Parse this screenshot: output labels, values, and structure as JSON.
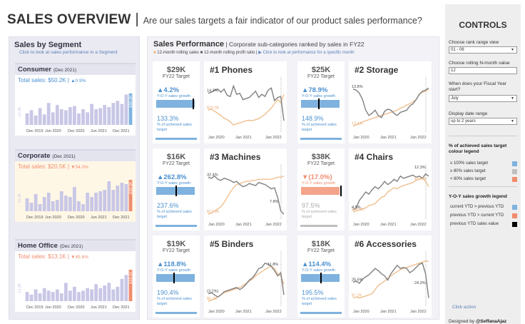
{
  "header": {
    "title": "SALES OVERVIEW",
    "separator": "|",
    "subtitle": "Are our sales targets a fair indicator of our product sales performance?"
  },
  "colors": {
    "blue": "#7fb2de",
    "orange": "#f08c6e",
    "gray": "#bfbfbf",
    "lavender": "#c9c7e6",
    "segment_blue_text": "#4a90d0",
    "segment_orange_text": "#f08c6e",
    "rolling_sales_line": "#f0c090",
    "rolling_profit_line": "#808080"
  },
  "segments": {
    "title": "Sales by Segment",
    "hint": "Click to look at sales performance in a Segment",
    "axis_labels": [
      "Dec 2019",
      "Jun 2020",
      "Dec 2020",
      "Jun 2021",
      "Dec 2021"
    ],
    "items": [
      {
        "name": "Consumer",
        "date": "(Dec 2021)",
        "total_text": "Total sales: $50.2K | ",
        "growth_text": "▲0.9%",
        "color": "#4a90d0",
        "highlight_color": "#7fb2de",
        "first_label": "£1.0K",
        "last_label": "£50.2K",
        "values": [
          22,
          28,
          18,
          32,
          20,
          42,
          24,
          38,
          30,
          28,
          34,
          36,
          22,
          30,
          24,
          40,
          30,
          32,
          38,
          34,
          42,
          46,
          40,
          58,
          60
        ]
      },
      {
        "name": "Corporate",
        "date": "(Dec 2021)",
        "total_text": "Total sales: $20.5K | ",
        "growth_text": "▼54.0%",
        "color": "#f08c6e",
        "highlight_color": "#f08c6e",
        "first_label": "£3.5K",
        "last_label": "£20.5K",
        "values": [
          18,
          12,
          24,
          10,
          20,
          26,
          14,
          16,
          28,
          22,
          20,
          34,
          14,
          10,
          26,
          20,
          26,
          28,
          30,
          42,
          30,
          36,
          40,
          38,
          44
        ]
      },
      {
        "name": "Home Office",
        "date": "(Dec 2021)",
        "total_text": "Total sales: $13.1K | ",
        "growth_text": "▼45.6%",
        "color": "#f08c6e",
        "highlight_color": "#f08c6e",
        "first_label": "£1.0K",
        "last_label": "£13.1K",
        "values": [
          14,
          10,
          18,
          12,
          20,
          16,
          14,
          18,
          12,
          28,
          16,
          22,
          14,
          16,
          20,
          18,
          26,
          20,
          24,
          28,
          18,
          22,
          34,
          40,
          48
        ]
      }
    ]
  },
  "performance": {
    "title": "Sales Performance",
    "separator": " | ",
    "subtitle": "Corporate sub-categories ranked by sales in FY22",
    "legend_item1": "12-month rolling sales",
    "legend_item2": "12-month rolling profit ratio",
    "legend_sep": " | ",
    "legend_click": "▶ Click to look at performance for a specific month",
    "axis_labels": [
      "Jan 2020",
      "Jan 2021",
      "Jan 2022"
    ],
    "target_label": "FY22 Target",
    "growth_label": "Y-O-Y sales growth",
    "achieved_label": "% of achieved sales target",
    "tiles": [
      {
        "rank": "#1 Phones",
        "target": "$29K",
        "growth": "▲4.2%",
        "growth_color": "#4a90d0",
        "growth_bar_color": "#7fb2de",
        "marker_pos": 0.95,
        "achieved": "133.3%",
        "achieved_color": "#4a90d0",
        "achieved_fill": 1.0,
        "sales_label": "$29.6K",
        "profit_label": "14.3%",
        "sales": [
          60,
          58,
          62,
          66,
          70,
          75,
          78,
          82,
          88,
          86,
          84,
          82,
          80,
          79,
          80,
          78,
          76,
          72,
          68,
          62,
          56,
          48,
          40,
          46,
          30
        ],
        "profit": [
          28,
          26,
          22,
          20,
          26,
          20,
          32,
          34,
          14,
          30,
          28,
          40,
          38,
          36,
          30,
          24,
          36,
          30,
          34,
          22,
          18,
          42,
          36,
          34,
          80
        ]
      },
      {
        "rank": "#2 Storage",
        "target": "$25K",
        "growth": "▲78.9%",
        "growth_color": "#4a90d0",
        "growth_bar_color": "#7fb2de",
        "marker_pos": 0.45,
        "achieved": "148.9%",
        "achieved_color": "#4a90d0",
        "achieved_fill": 1.0,
        "sales_label": "13.4%",
        "profit_label": "13.8%",
        "sales": [
          90,
          88,
          86,
          82,
          80,
          78,
          76,
          74,
          72,
          70,
          68,
          66,
          64,
          62,
          60,
          56,
          54,
          50,
          48,
          44,
          40,
          30,
          26,
          24,
          20
        ],
        "profit": [
          20,
          22,
          28,
          40,
          60,
          70,
          66,
          60,
          70,
          74,
          62,
          58,
          60,
          66,
          70,
          64,
          62,
          60,
          52,
          48,
          40,
          30,
          24,
          22,
          18
        ]
      },
      {
        "rank": "#3 Machines",
        "target": "$16K",
        "growth": "▲262.8%",
        "growth_color": "#4a90d0",
        "growth_bar_color": "#7fb2de",
        "marker_pos": 0.5,
        "achieved": "237.6%",
        "achieved_color": "#4a90d0",
        "achieved_fill": 1.0,
        "sales_label": "$17.9K",
        "profit_label": "32.4%",
        "sales": [
          92,
          90,
          86,
          82,
          78,
          70,
          60,
          50,
          42,
          36,
          34,
          32,
          30,
          30,
          28,
          28,
          26,
          26,
          26,
          26,
          26,
          24,
          22,
          22,
          20
        ],
        "profit": [
          22,
          24,
          20,
          26,
          28,
          24,
          26,
          28,
          32,
          30,
          36,
          40,
          38,
          34,
          36,
          38,
          32,
          34,
          36,
          40,
          44,
          42,
          60,
          86,
          92
        ]
      },
      {
        "rank": "#4 Chairs",
        "target": "$38K",
        "growth": "▼(17.0%)",
        "growth_color": "#f08c6e",
        "growth_bar_color": "#f4a48a",
        "marker_pos": 1.05,
        "achieved": "97.5%",
        "achieved_color": "#aaaaaa",
        "achieved_fill": 0.9,
        "sales_label": "$38.6K",
        "profit_label": "4.5%",
        "sales": [
          88,
          86,
          84,
          82,
          80,
          76,
          74,
          72,
          66,
          60,
          58,
          50,
          46,
          42,
          44,
          40,
          38,
          36,
          34,
          32,
          28,
          26,
          24,
          30,
          40
        ],
        "profit": [
          84,
          80,
          66,
          58,
          50,
          54,
          46,
          40,
          44,
          38,
          30,
          36,
          32,
          26,
          30,
          20,
          24,
          22,
          20,
          18,
          22,
          20,
          24,
          16,
          20
        ]
      },
      {
        "rank": "#5 Binders",
        "target": "$19K",
        "growth": "▲118.8%",
        "growth_color": "#4a90d0",
        "growth_bar_color": "#7fb2de",
        "marker_pos": 0.45,
        "achieved": "190.4%",
        "achieved_color": "#4a90d0",
        "achieved_fill": 1.0,
        "sales_label": "$6.2K",
        "profit_label": "(3.1%)",
        "sales": [
          92,
          90,
          88,
          84,
          80,
          76,
          74,
          72,
          70,
          68,
          66,
          62,
          58,
          54,
          50,
          44,
          40,
          36,
          32,
          28,
          26,
          30,
          40,
          44,
          60
        ],
        "profit": [
          78,
          76,
          80,
          84,
          80,
          74,
          72,
          70,
          68,
          66,
          70,
          66,
          60,
          52,
          48,
          40,
          30,
          28,
          20,
          22,
          26,
          34,
          44,
          38,
          80
        ]
      },
      {
        "rank": "#6 Accessories",
        "target": "$18K",
        "growth": "▲114.4%",
        "growth_color": "#4a90d0",
        "growth_bar_color": "#7fb2de",
        "marker_pos": 0.5,
        "achieved": "195.5%",
        "achieved_color": "#4a90d0",
        "achieved_fill": 1.0,
        "sales_label": "$7.2K",
        "profit_label": "25.6%",
        "sales": [
          86,
          84,
          86,
          84,
          82,
          80,
          78,
          70,
          62,
          58,
          54,
          48,
          44,
          40,
          36,
          32,
          30,
          28,
          26,
          24,
          22,
          20,
          18,
          16,
          16
        ],
        "profit": [
          56,
          54,
          58,
          50,
          46,
          42,
          36,
          30,
          34,
          40,
          44,
          52,
          40,
          32,
          24,
          30,
          28,
          30,
          38,
          34,
          28,
          22,
          20,
          40,
          86
        ]
      }
    ],
    "end_labels": [
      "11.8%",
      "24.3%",
      "7.8%",
      "12.3%",
      "$19.4K"
    ]
  },
  "controls": {
    "title": "CONTROLS",
    "rank_range_label": "Choose rank range view",
    "rank_range_value": "01 - 06",
    "rolling_label": "Choose rolling N-month value",
    "rolling_value": "12",
    "fiscal_label": "When does your Fiscal Year start?",
    "fiscal_value": "July",
    "date_range_label": "Display date range",
    "date_range_value": "up to 2 years",
    "achieved_legend_title": "% of achieved sales target colour legend",
    "achieved_legend": [
      {
        "label": "≥ 100% sales target",
        "color": "#7fb2de"
      },
      {
        "label": "≥ 80% sales target",
        "color": "#bfbfbf"
      },
      {
        "label": "< 80% sales target",
        "color": "#f08c6e"
      }
    ],
    "growth_legend_title": "Y-O-Y sales growth legend",
    "growth_legend": [
      {
        "label": "current YTD > previous YTD",
        "color": "#7fb2de"
      },
      {
        "label": "previous YTD > current YTD",
        "color": "#f08c6e"
      },
      {
        "label": "previous YTD sales value",
        "color": "#000000"
      }
    ],
    "click_action": "Click action",
    "designed_by": "Designed by ",
    "designer": "@SeffanaAjaz"
  }
}
